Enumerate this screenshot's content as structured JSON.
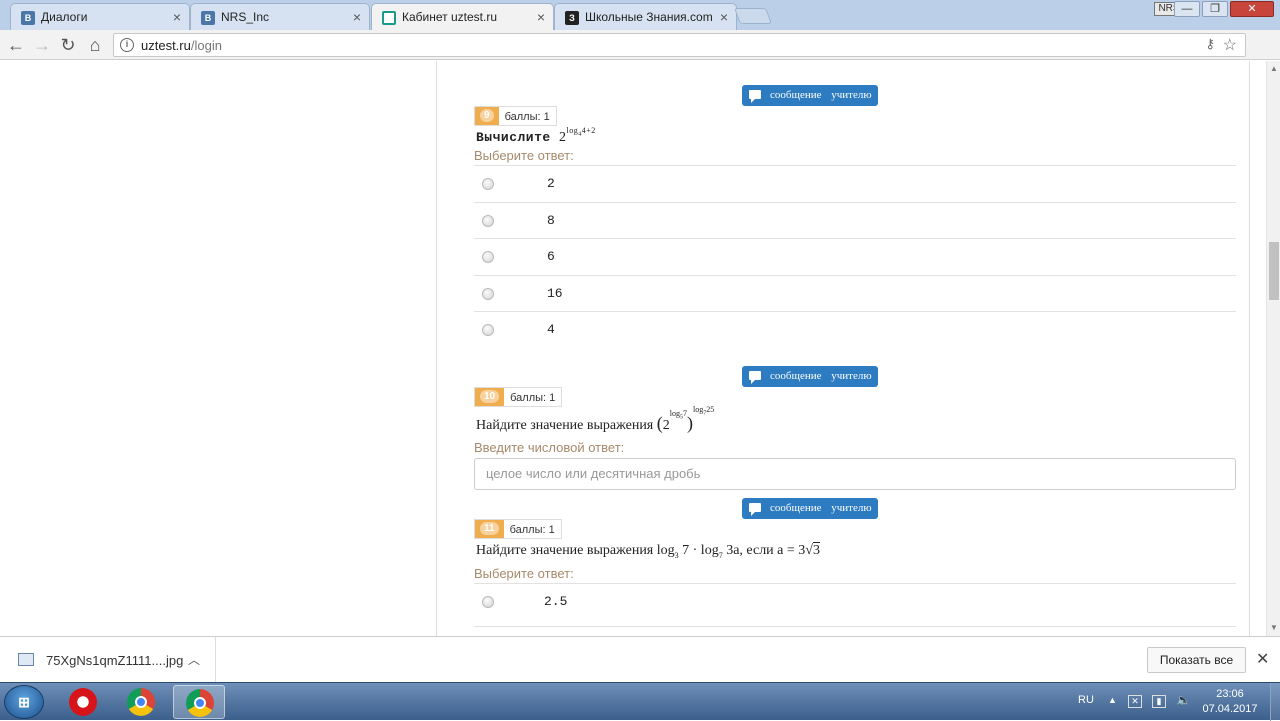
{
  "browser": {
    "tabs": [
      {
        "title": "Диалоги",
        "favicon": "vk-icon",
        "active": false
      },
      {
        "title": "NRS_Inc",
        "favicon": "vk-icon",
        "active": false
      },
      {
        "title": "Кабинет uztest.ru",
        "favicon": "uztest-icon",
        "active": true
      },
      {
        "title": "Школьные Знания.com",
        "favicon": "znanija-icon",
        "active": false
      }
    ],
    "profile_badge": "NRS",
    "url_host": "uztest.ru",
    "url_path": "/login"
  },
  "page": {
    "message_button_label": "сообщение учителю",
    "questions": [
      {
        "number": "9",
        "points_label": "баллы: 1",
        "prompt": "Вычислите",
        "expr_base": "2",
        "expr_exp": "log",
        "expr_exp_sub": "4",
        "expr_exp_tail": "4+2",
        "answer_hint": "Выберите ответ:",
        "options": [
          "2",
          "8",
          "6",
          "16",
          "4"
        ]
      },
      {
        "number": "10",
        "points_label": "баллы: 1",
        "prompt": "Найдите значение выражения",
        "expr_inner_base": "2",
        "expr_inner_exp": "log",
        "expr_inner_exp_sub": "5",
        "expr_inner_exp_tail": "7",
        "expr_outer_exp": "log",
        "expr_outer_exp_sub": "7",
        "expr_outer_exp_tail": "25",
        "answer_hint": "Введите числовой ответ:",
        "input_placeholder": "целое число или десятичная дробь"
      },
      {
        "number": "11",
        "points_label": "баллы: 1",
        "prompt": "Найдите значение выражения",
        "expr": "log",
        "expr_sub1": "3",
        "expr_mid": "7 · log",
        "expr_sub2": "7",
        "expr_tail": "3a,  если a = 3",
        "expr_root": "3",
        "answer_hint": "Выберите ответ:",
        "options": [
          "2.5"
        ]
      }
    ]
  },
  "downloads": {
    "file_name": "75XgNs1qmZ1111....jpg",
    "show_all_label": "Показать все"
  },
  "taskbar": {
    "apps": [
      "opera",
      "chrome",
      "chrome"
    ],
    "lang": "RU",
    "time": "23:06",
    "date": "07.04.2017"
  }
}
